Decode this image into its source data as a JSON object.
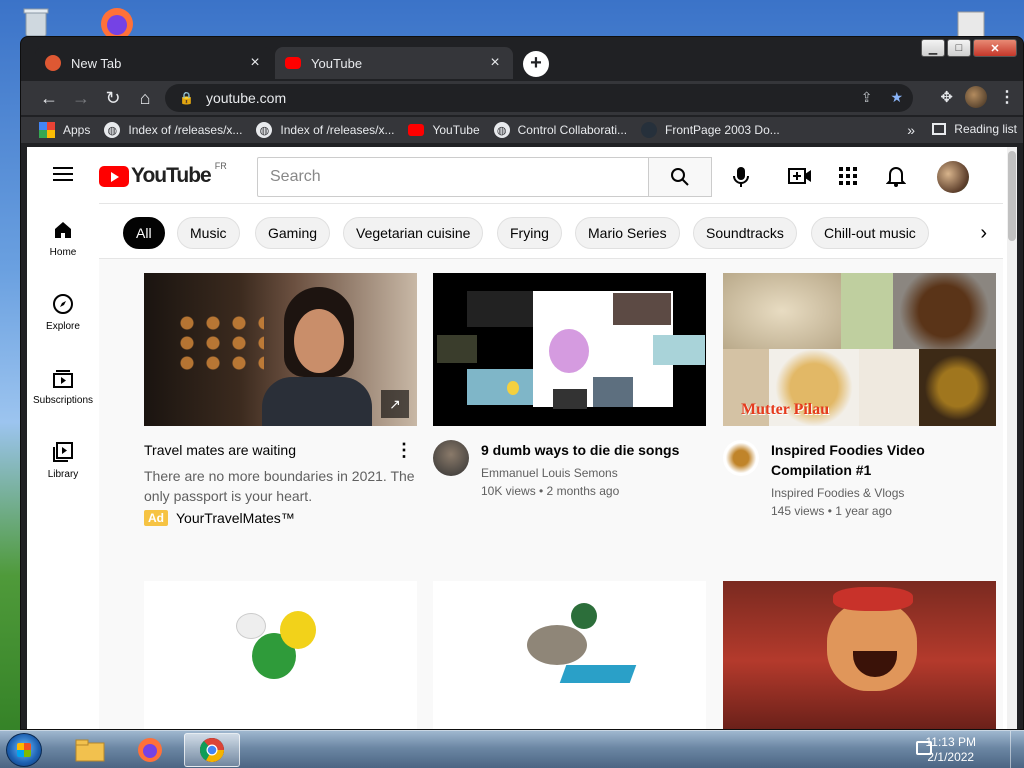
{
  "browser": {
    "tabs": [
      {
        "title": "New Tab",
        "close": "×"
      },
      {
        "title": "YouTube",
        "close": "×"
      }
    ],
    "new_tab": "+",
    "url": "youtube.com",
    "bookmarks": [
      {
        "label": "Apps",
        "icon": "apps-grid-icon"
      },
      {
        "label": "Index of /releases/x...",
        "icon": "globe-icon"
      },
      {
        "label": "Index of /releases/x...",
        "icon": "globe-icon"
      },
      {
        "label": "YouTube",
        "icon": "youtube-icon"
      },
      {
        "label": "Control Collaborati...",
        "icon": "globe-icon"
      },
      {
        "label": "FrontPage 2003 Do...",
        "icon": "frontpage-icon"
      }
    ],
    "bookmarks_more": "»",
    "reading_list": "Reading list"
  },
  "youtube": {
    "logo_text": "YouTube",
    "region": "FR",
    "search_placeholder": "Search",
    "sidebar": [
      {
        "label": "Home",
        "icon": "home-icon"
      },
      {
        "label": "Explore",
        "icon": "compass-icon"
      },
      {
        "label": "Subscriptions",
        "icon": "subscriptions-icon"
      },
      {
        "label": "Library",
        "icon": "library-icon"
      }
    ],
    "chips": [
      "All",
      "Music",
      "Gaming",
      "Vegetarian cuisine",
      "Frying",
      "Mario Series",
      "Soundtracks",
      "Chill-out music"
    ],
    "chip_next": "›",
    "videos": [
      {
        "title": "Travel mates are waiting",
        "description": "There are no more boundaries in 2021. The only passport is your heart.",
        "ad_badge": "Ad",
        "advertiser": "YourTravelMates™",
        "menu": "⋮"
      },
      {
        "title": "9 dumb ways to die die songs",
        "channel": "Emmanuel Louis Semons",
        "stats": "10K views • 2 months ago"
      },
      {
        "title": "Inspired Foodies Video Compilation #1",
        "channel": "Inspired Foodies & Vlogs",
        "stats": "145 views • 1 year ago",
        "thumb_text": "Mutter Pilau"
      }
    ]
  },
  "taskbar": {
    "time": "11:13 PM",
    "date": "2/1/2022"
  },
  "colors": {
    "youtube_red": "#ff0000",
    "chrome_dark": "#202124",
    "chrome_toolbar": "#35363a",
    "accent_blue": "#8ab4f8"
  }
}
